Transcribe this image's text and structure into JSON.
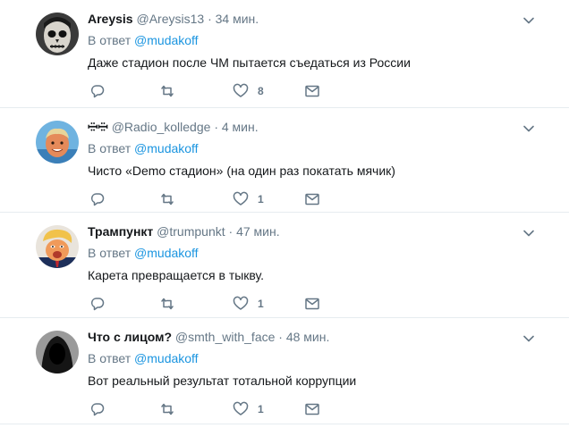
{
  "tweets": [
    {
      "display_name": "Areysis",
      "handle": "@Areysis13",
      "dot": "·",
      "time": "34 мин.",
      "reply_prefix": "В ответ",
      "reply_to": "@mudakoff",
      "text": "Даже стадион после ЧМ пытается съедаться из России",
      "likes": "8",
      "avatar_icon": "skull-face-avatar"
    },
    {
      "display_name": "ꟷ̤̈ꟷ̤̈",
      "handle": "@Radio_kolledge",
      "dot": "·",
      "time": "4 мин.",
      "reply_prefix": "В ответ",
      "reply_to": "@mudakoff",
      "text": "Чисто «Demo стадион» (на один раз покатать мячик)",
      "likes": "1",
      "avatar_icon": "sunburnt-man-avatar"
    },
    {
      "display_name": "Трампункт",
      "handle": "@trumpunkt",
      "dot": "·",
      "time": "47 мин.",
      "reply_prefix": "В ответ",
      "reply_to": "@mudakoff",
      "text": "Карета превращается в тыкву.",
      "likes": "1",
      "avatar_icon": "caricature-avatar"
    },
    {
      "display_name": "Что с лицом?",
      "handle": "@smth_with_face",
      "dot": "·",
      "time": "48 мин.",
      "reply_prefix": "В ответ",
      "reply_to": "@mudakoff",
      "text": "Вот реальный результат тотальной коррупции",
      "likes": "1",
      "avatar_icon": "hooded-figure-avatar"
    }
  ],
  "colors": {
    "text": "#14171a",
    "secondary": "#657786",
    "link": "#1b95e0",
    "divider": "#e6ecf0"
  }
}
